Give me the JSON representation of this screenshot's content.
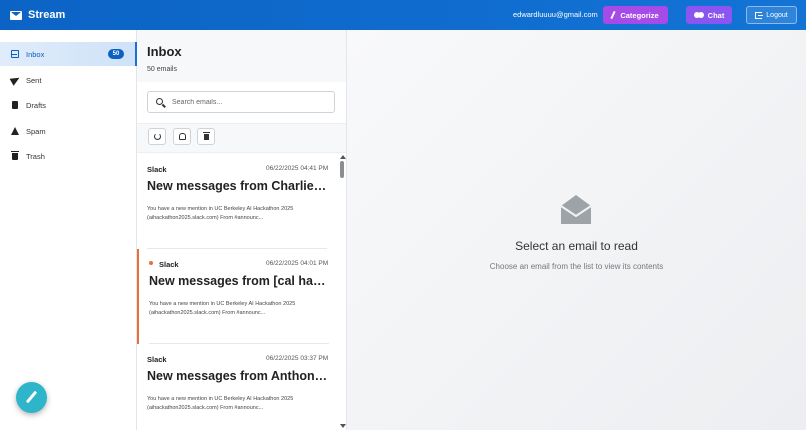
{
  "header": {
    "app_name": "Stream",
    "user_email": "edwardluuuu@gmail.com",
    "categorize_label": "Categorize",
    "chat_label": "Chat",
    "logout_label": "Logout",
    "colors": {
      "bar": "#0b63c5",
      "categorize": "#a74be8",
      "chat": "#8b55f0"
    }
  },
  "sidebar": {
    "items": [
      {
        "label": "Inbox",
        "icon": "inbox-icon",
        "badge": "50",
        "active": true
      },
      {
        "label": "Sent",
        "icon": "send-icon"
      },
      {
        "label": "Drafts",
        "icon": "file-icon"
      },
      {
        "label": "Spam",
        "icon": "warning-icon"
      },
      {
        "label": "Trash",
        "icon": "trash-icon"
      }
    ]
  },
  "list": {
    "title": "Inbox",
    "count": "50 emails",
    "search_placeholder": "Search emails...",
    "emails": [
      {
        "sender": "Slack",
        "date": "06/22/2025 04:41 PM",
        "subject": "New messages from Charlie [cal hackathon]",
        "preview": "You have a new mention in UC Berkeley AI Hackathon 2025 (aihackathon2025.slack.com) From #announc...",
        "unread": false
      },
      {
        "sender": "Slack",
        "date": "06/22/2025 04:01 PM",
        "subject": "New messages from [cal hackathon]",
        "preview": "You have a new mention in UC Berkeley AI Hackathon 2025 (aihackathon2025.slack.com) From #announc...",
        "unread": true
      },
      {
        "sender": "Slack",
        "date": "06/22/2025 03:37 PM",
        "subject": "New messages from Anthony [cal hackathon]",
        "preview": "You have a new mention in UC Berkeley AI Hackathon 2025 (aihackathon2025.slack.com) From #announc...",
        "unread": false
      }
    ]
  },
  "reader": {
    "empty_title": "Select an email to read",
    "empty_subtitle": "Choose an email from the list to view its contents"
  }
}
